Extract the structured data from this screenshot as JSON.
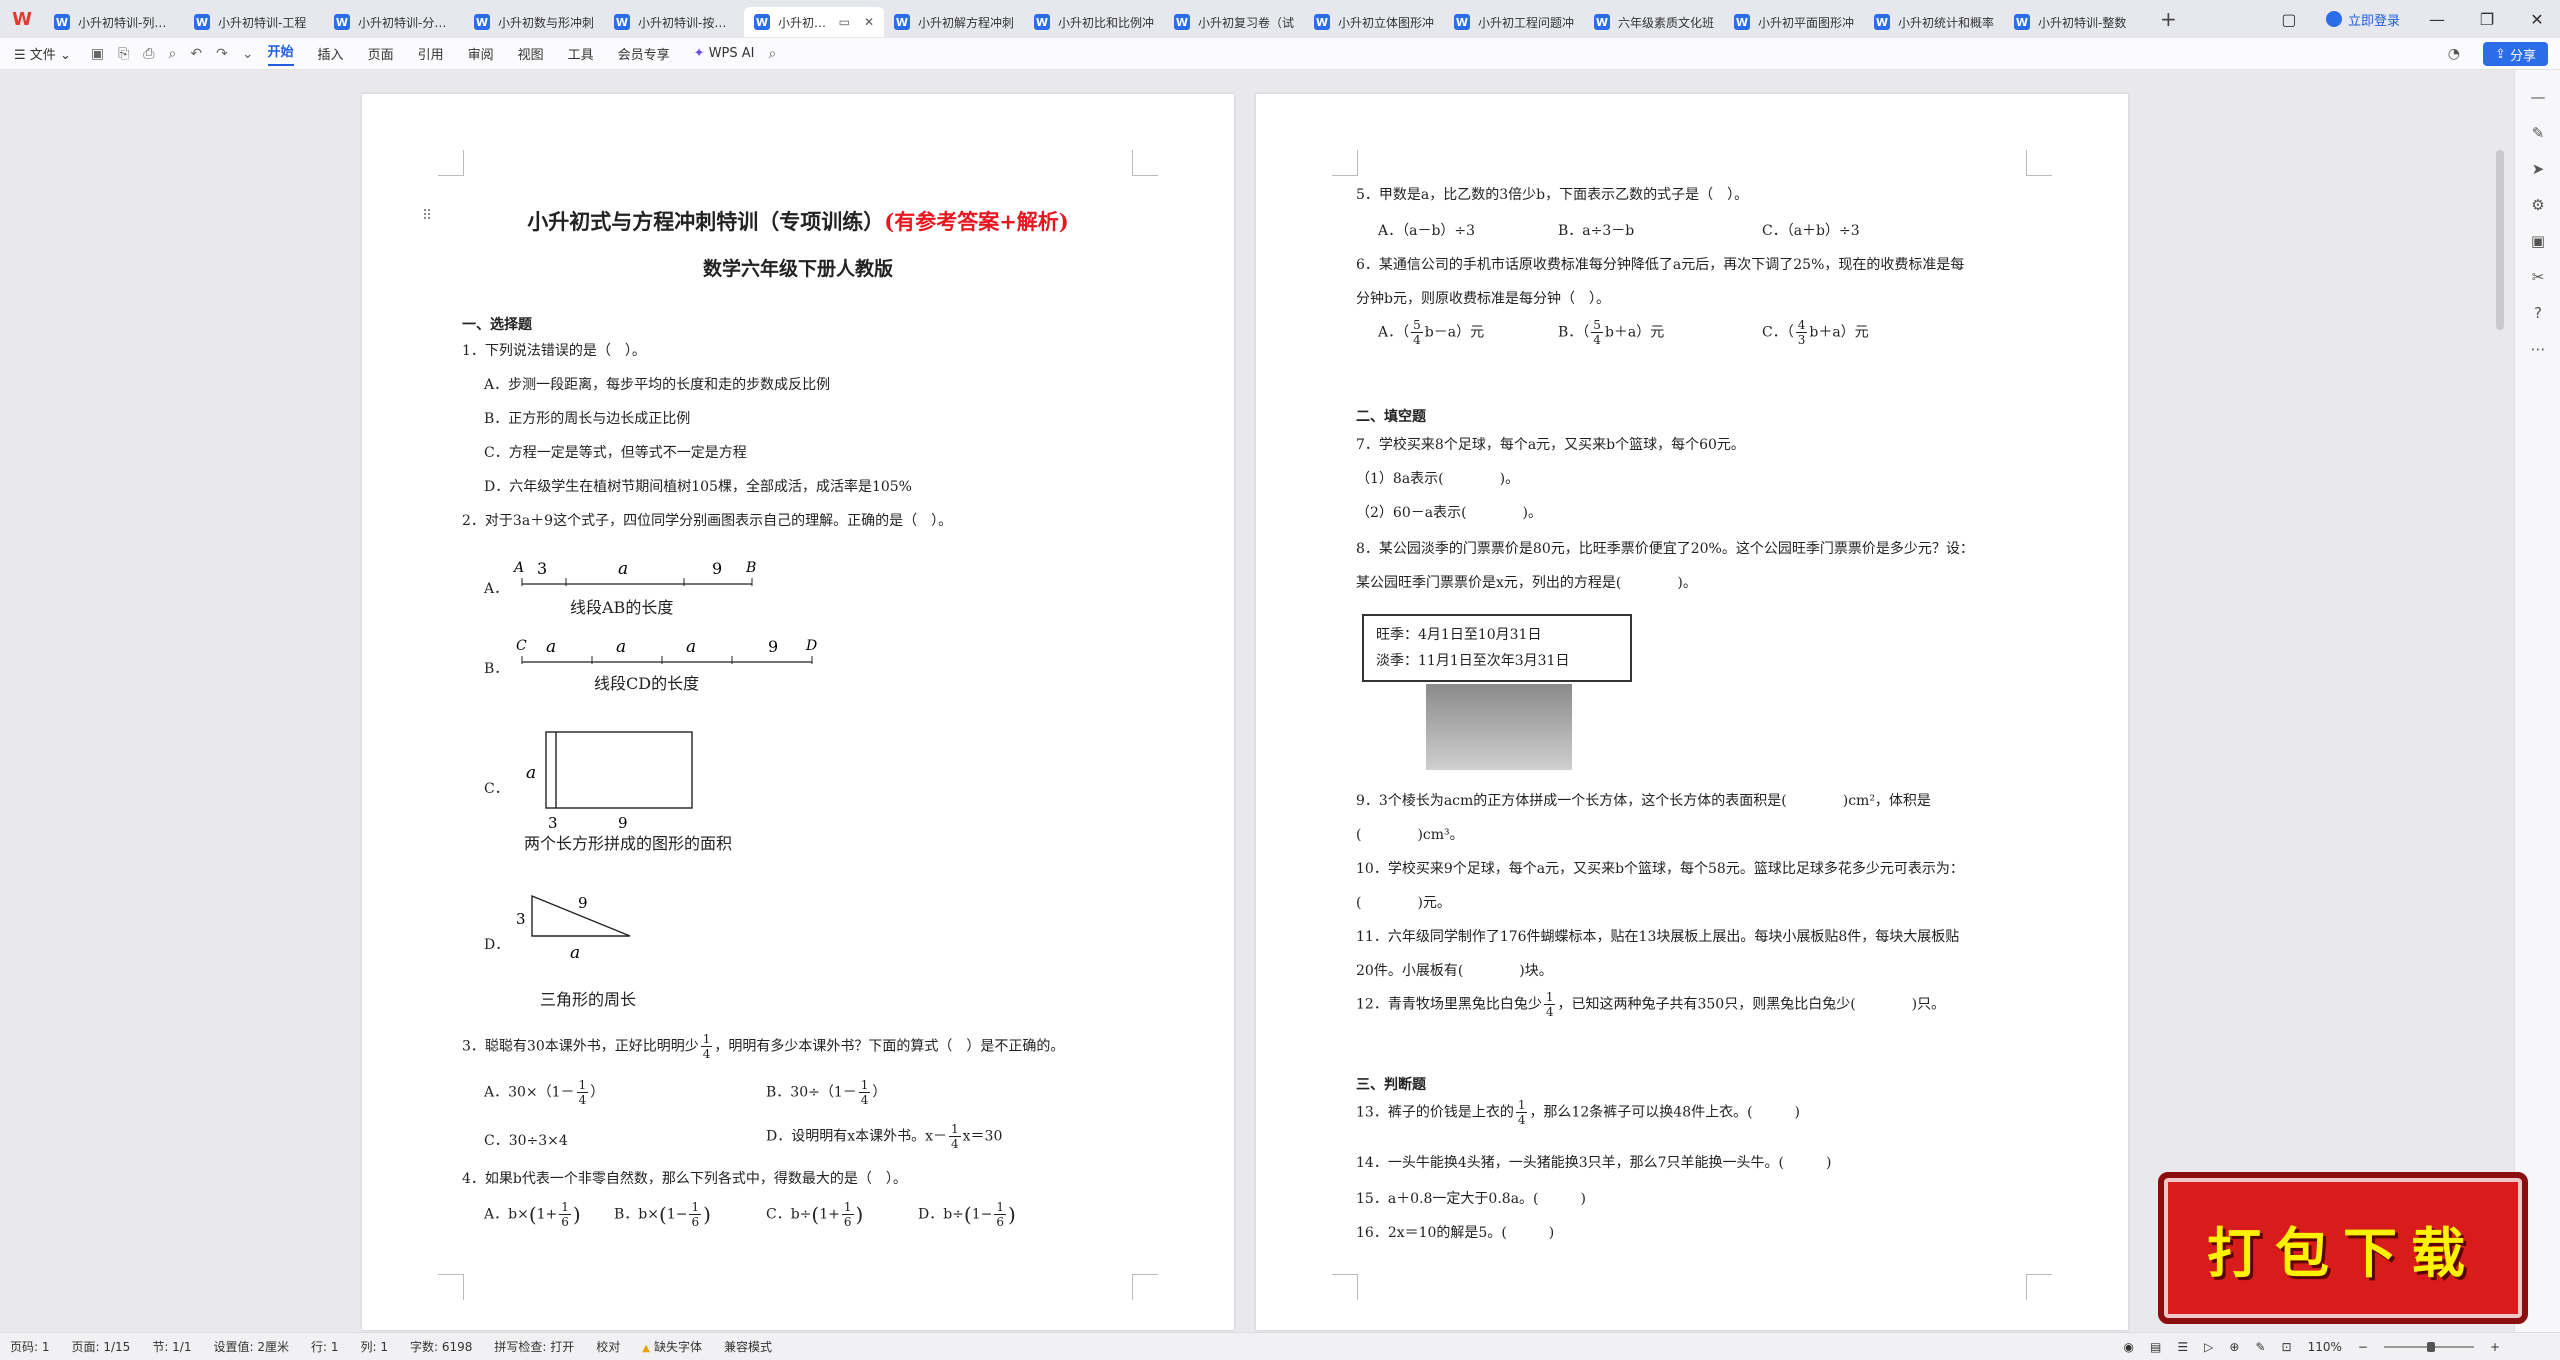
{
  "tabs": [
    {
      "label": "小升初特训-列方程"
    },
    {
      "label": "小升初特训-工程"
    },
    {
      "label": "小升初特训-分数百"
    },
    {
      "label": "小升初数与形冲刺"
    },
    {
      "label": "小升初特训-按比分"
    },
    {
      "label": "小升初式与",
      "active": true
    },
    {
      "label": "小升初解方程冲刺"
    },
    {
      "label": "小升初比和比例冲"
    },
    {
      "label": "小升初复习卷（试"
    },
    {
      "label": "小升初立体图形冲"
    },
    {
      "label": "小升初工程问题冲"
    },
    {
      "label": "六年级素质文化班"
    },
    {
      "label": "小升初平面图形冲"
    },
    {
      "label": "小升初统计和概率"
    },
    {
      "label": "小升初特训-整数"
    }
  ],
  "titlebar": {
    "login": "立即登录",
    "w_icon": "W"
  },
  "menu": {
    "file": "文件",
    "items": [
      "开始",
      "插入",
      "页面",
      "引用",
      "审阅",
      "视图",
      "工具",
      "会员专享"
    ],
    "wps_ai": "WPS AI",
    "share": "分享"
  },
  "doc": {
    "title_main": "小升初式与方程冲刺特训（专项训练）",
    "title_red": "(有参考答案+解析)",
    "subtitle": "数学六年级下册人教版",
    "sec1": "一、选择题",
    "q1": "1．下列说法错误的是（　）。",
    "q1_a": "A．步测一段距离，每步平均的长度和走的步数成反比例",
    "q1_b": "B．正方形的周长与边长成正比例",
    "q1_c": "C．方程一定是等式，但等式不一定是方程",
    "q1_d": "D．六年级学生在植树节期间植树105棵，全部成活，成活率是105%",
    "q2": "2．对于3a＋9这个式子，四位同学分别画图表示自己的理解。正确的是（　）。",
    "q2_opt_a": "A．",
    "q2_a_labels": {
      "a_pt": "A",
      "n3": "3",
      "a": "a",
      "n9": "9",
      "b_pt": "B"
    },
    "q2_a_caption": "线段AB的长度",
    "q2_opt_b": "B．",
    "q2_b_labels": {
      "c_pt": "C",
      "a1": "a",
      "a2": "a",
      "a3": "a",
      "n9": "9",
      "d_pt": "D"
    },
    "q2_b_caption": "线段CD的长度",
    "q2_opt_c": "C．",
    "q2_c_labels": {
      "a": "a",
      "n3": "3",
      "n9": "9"
    },
    "q2_c_caption": "两个长方形拼成的图形的面积",
    "q2_opt_d": "D．",
    "q2_d_labels": {
      "n3": "3",
      "n9": "9",
      "a": "a"
    },
    "q2_d_caption": "三角形的周长",
    "q3_pre": "3．聪聪有30本课外书，正好比明明少",
    "q3_post": "，明明有多少本课外书？下面的算式（　）是不正确的。",
    "q3_a": "A．30×（1－",
    "q3_b": "B．30÷（1－",
    "q3_c": "C．30÷3×4",
    "q3_d": "D．设明明有x本课外书。x－",
    "q3_d_post": "x＝30",
    "q4": "4．如果b代表一个非零自然数，那么下列各式中，得数最大的是（　）。",
    "q4_a": "A．b×",
    "q4_b": "B．b×",
    "q4_c": "C．b÷",
    "q4_d": "D．b÷",
    "frac_1_4": {
      "n": "1",
      "d": "4"
    },
    "frac_1_6": {
      "n": "1",
      "d": "6"
    },
    "frac_5_4": {
      "n": "5",
      "d": "4"
    },
    "frac_4_3": {
      "n": "4",
      "d": "3"
    },
    "one": "1",
    "plus": "+",
    "minus": "−",
    "close": ")",
    "close_paren": "）",
    "q5": "5．甲数是a，比乙数的3倍少b，下面表示乙数的式子是（　）。",
    "q5_a": "A．（a－b）÷3",
    "q5_b": "B．a÷3－b",
    "q5_c": "C．（a＋b）÷3",
    "q6_l1": "6．某通信公司的手机市话原收费标准每分钟降低了a元后，再次下调了25%，现在的收费标准是每",
    "q6_l2": "分钟b元，则原收费标准是每分钟（　）。",
    "q6_a": "A．（",
    "q6_a_post": "b－a）元",
    "q6_b": "B．（",
    "q6_b_post": "b＋a）元",
    "q6_c": "C．（",
    "q6_c_post": "b＋a）元",
    "sec2": "二、填空题",
    "q7": "7．学校买来8个足球，每个a元，又买来b个篮球，每个60元。",
    "q7_1": "（1）8a表示(　　　　)。",
    "q7_2": "（2）60－a表示(　　　　)。",
    "q8_l1": "8．某公园淡季的门票票价是80元，比旺季票价便宜了20%。这个公园旺季门票票价是多少元？设：",
    "q8_l2": "某公园旺季门票票价是x元，列出的方程是(　　　　)。",
    "sign_l1": "旺季：4月1日至10月31日",
    "sign_l2": "淡季：11月1日至次年3月31日",
    "q9_l1": "9．3个棱长为acm的正方体拼成一个长方体，这个长方体的表面积是(　　　　)cm²，体积是",
    "q9_l2": "(　　　　)cm³。",
    "q10_l1": "10．学校买来9个足球，每个a元，又买来b个篮球，每个58元。篮球比足球多花多少元可表示为：",
    "q10_l2": "(　　　　)元。",
    "q11_l1": "11．六年级同学制作了176件蝴蝶标本，贴在13块展板上展出。每块小展板贴8件，每块大展板贴",
    "q11_l2": "20件。小展板有(　　　　)块。",
    "q12_pre": "12．青青牧场里黑兔比白兔少",
    "q12_post": "，已知这两种兔子共有350只，则黑兔比白兔少(　　　　)只。",
    "sec3": "三、判断题",
    "q13_pre": "13．裤子的价钱是上衣的",
    "q13_post": "，那么12条裤子可以换48件上衣。(　　　)",
    "q14": "14．一头牛能换4头猪，一头猪能换3只羊，那么7只羊能换一头牛。(　　　)",
    "q15": "15．a＋0.8一定大于0.8a。(　　　)",
    "q16": "16．2x＝10的解是5。(　　　)"
  },
  "status": {
    "page": "页码: 1",
    "pages": "页面: 1/15",
    "section": "节: 1/1",
    "setting": "设置值: 2厘米",
    "row": "行: 1",
    "col": "列: 1",
    "words": "字数: 6198",
    "spell": "拼写检查: 打开",
    "proof": "校对",
    "missing_font": "缺失字体",
    "compat": "兼容模式",
    "zoom": "110%"
  },
  "stamp": {
    "text": "打包下载"
  },
  "colors": {
    "accent": "#1f5ed8",
    "title_red": "#e8161f",
    "stamp_red": "#d81b1b",
    "stamp_text": "#fff200"
  }
}
